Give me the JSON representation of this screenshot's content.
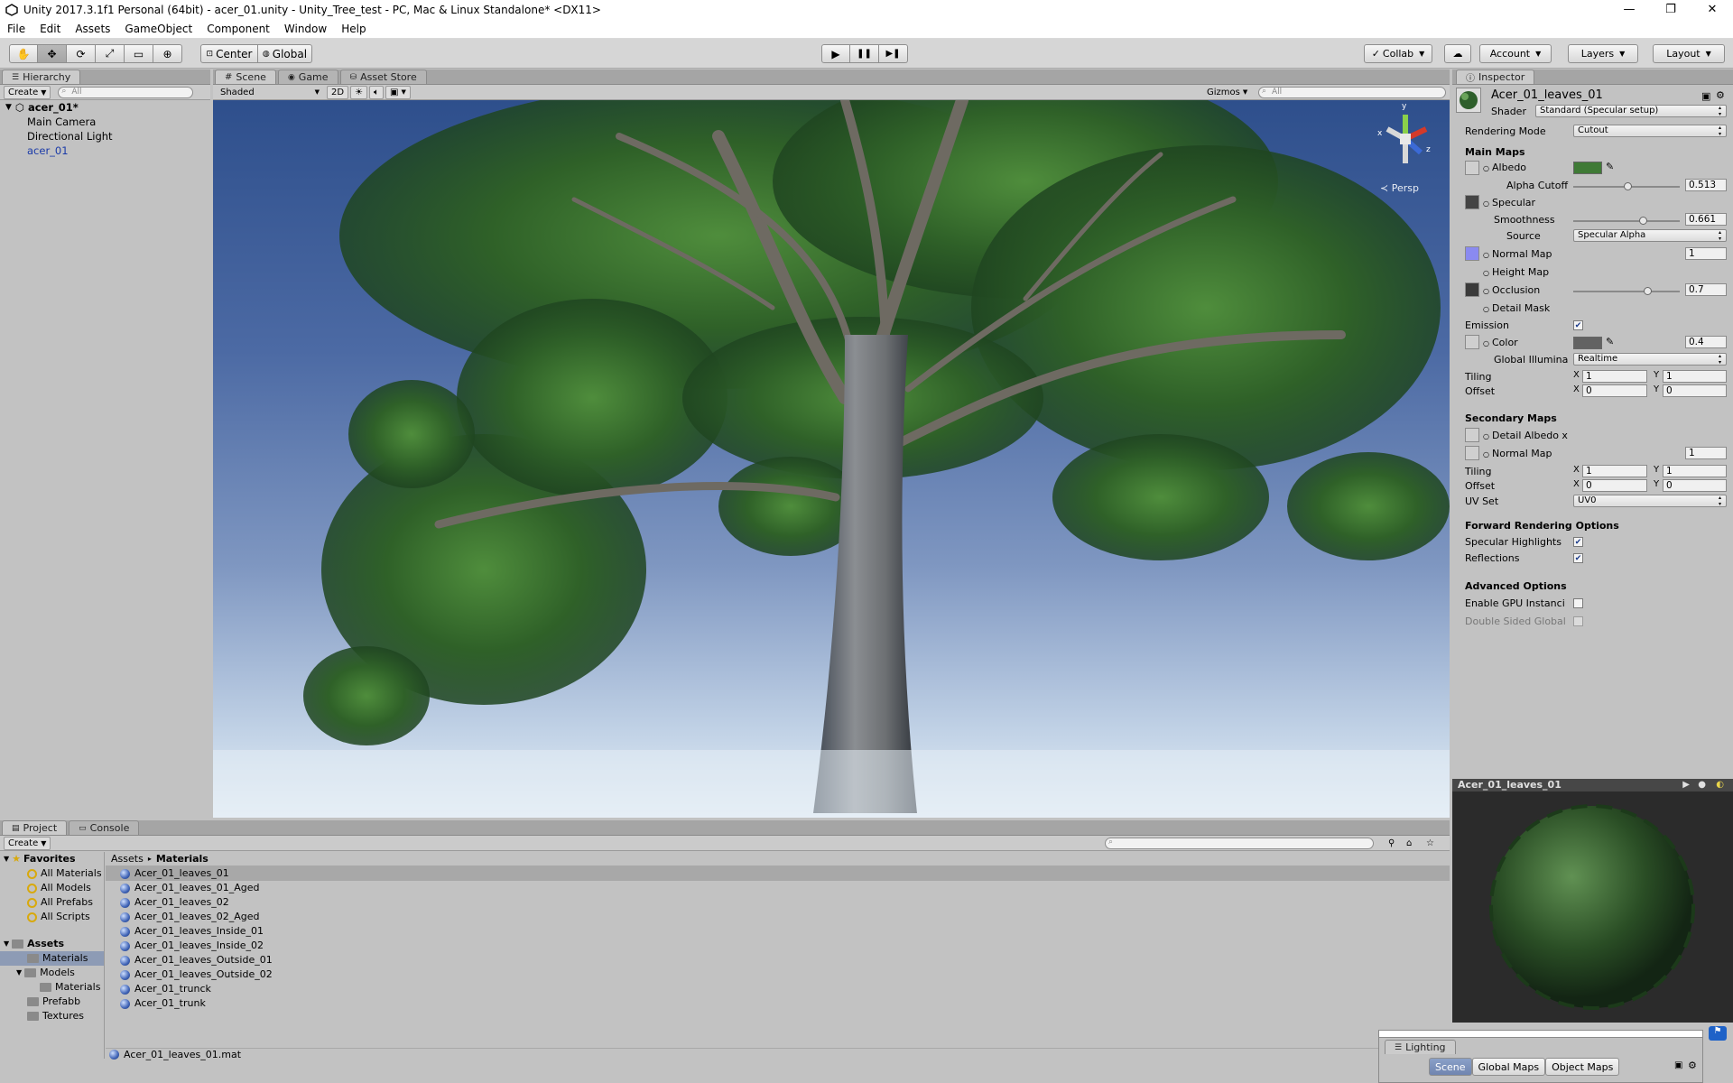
{
  "window": {
    "title": "Unity 2017.3.1f1 Personal (64bit) - acer_01.unity - Unity_Tree_test - PC, Mac & Linux Standalone* <DX11>",
    "controls": [
      "—",
      "❐",
      "✕"
    ]
  },
  "menu": [
    "File",
    "Edit",
    "Assets",
    "GameObject",
    "Component",
    "Window",
    "Help"
  ],
  "toolbar": {
    "tools": [
      "hand-tool",
      "move-tool",
      "rotate-tool",
      "scale-tool",
      "rect-tool",
      "transform-tool"
    ],
    "pivot_label": "Center",
    "space_label": "Global",
    "play_icons": [
      "▶",
      "❚❚",
      "▶❚"
    ],
    "collab_label": "Collab",
    "account_label": "Account",
    "layers_label": "Layers",
    "layout_label": "Layout"
  },
  "hierarchy": {
    "tab_label": "Hierarchy",
    "create_label": "Create",
    "search_placeholder": "All",
    "scene_name": "acer_01*",
    "items": [
      "Main Camera",
      "Directional Light",
      "acer_01"
    ]
  },
  "scene": {
    "tabs": [
      "Scene",
      "Game",
      "Asset Store"
    ],
    "shading_mode": "Shaded",
    "mode_2d": "2D",
    "gizmos_label": "Gizmos",
    "search_placeholder": "All",
    "persp_label": "Persp",
    "axis_labels": [
      "y",
      "z",
      "x"
    ]
  },
  "inspector": {
    "tab_label": "Inspector",
    "material_name": "Acer_01_leaves_01",
    "shader_label": "Shader",
    "shader_value": "Standard (Specular setup)",
    "rendering_mode_label": "Rendering Mode",
    "rendering_mode_value": "Cutout",
    "main_maps_header": "Main Maps",
    "albedo_label": "Albedo",
    "albedo_color": "#3f7a36",
    "alpha_cutoff_label": "Alpha Cutoff",
    "alpha_cutoff_value": "0.513",
    "alpha_cutoff_fraction": 0.513,
    "specular_label": "Specular",
    "smoothness_label": "Smoothness",
    "smoothness_value": "0.661",
    "smoothness_fraction": 0.661,
    "source_label": "Source",
    "source_value": "Specular Alpha",
    "normal_map_label": "Normal Map",
    "normal_map_value": "1",
    "height_map_label": "Height Map",
    "occlusion_label": "Occlusion",
    "occlusion_value": "0.7",
    "occlusion_fraction": 0.7,
    "detail_mask_label": "Detail Mask",
    "emission_label": "Emission",
    "emission_checked": true,
    "color_label": "Color",
    "emission_color": "#626262",
    "emission_value": "0.4",
    "gi_label": "Global Illumina",
    "gi_value": "Realtime",
    "tiling_label": "Tiling",
    "offset_label": "Offset",
    "main_tiling": {
      "x": "1",
      "y": "1"
    },
    "main_offset": {
      "x": "0",
      "y": "0"
    },
    "x_label": "X",
    "y_label": "Y",
    "secondary_maps_header": "Secondary Maps",
    "detail_albedo_label": "Detail Albedo x",
    "secondary_normal_label": "Normal Map",
    "secondary_normal_value": "1",
    "secondary_tiling": {
      "x": "1",
      "y": "1"
    },
    "secondary_offset": {
      "x": "0",
      "y": "0"
    },
    "uv_set_label": "UV Set",
    "uv_set_value": "UV0",
    "forward_header": "Forward Rendering Options",
    "specular_highlights_label": "Specular Highlights",
    "specular_highlights_checked": true,
    "reflections_label": "Reflections",
    "reflections_checked": true,
    "advanced_header": "Advanced Options",
    "gpu_instancing_label": "Enable GPU Instanci",
    "gpu_instancing_checked": false,
    "double_sided_label": "Double Sided Global",
    "double_sided_checked": false
  },
  "preview": {
    "title": "Acer_01_leaves_01"
  },
  "project": {
    "tabs": [
      "Project",
      "Console"
    ],
    "create_label": "Create",
    "favorites_header": "Favorites",
    "favorites": [
      "All Materials",
      "All Models",
      "All Prefabs",
      "All Scripts"
    ],
    "assets_header": "Assets",
    "tree": [
      {
        "label": "Materials",
        "indent": 1,
        "selected": true
      },
      {
        "label": "Models",
        "indent": 1,
        "selected": false
      },
      {
        "label": "Materials",
        "indent": 2,
        "selected": false
      },
      {
        "label": "Prefabb",
        "indent": 1,
        "selected": false
      },
      {
        "label": "Textures",
        "indent": 1,
        "selected": false
      }
    ],
    "breadcrumb": [
      "Assets",
      "Materials"
    ],
    "breadcrumb_sep": "▸",
    "files": [
      "Acer_01_leaves_01",
      "Acer_01_leaves_01_Aged",
      "Acer_01_leaves_02",
      "Acer_01_leaves_02_Aged",
      "Acer_01_leaves_Inside_01",
      "Acer_01_leaves_Inside_02",
      "Acer_01_leaves_Outside_01",
      "Acer_01_leaves_Outside_02",
      "Acer_01_trunck",
      "Acer_01_trunk"
    ],
    "selected_file": "Acer_01_leaves_01",
    "footer_path": "Acer_01_leaves_01.mat"
  },
  "lighting": {
    "tab_label": "Lighting",
    "tabs": [
      "Scene",
      "Global Maps",
      "Object Maps"
    ]
  }
}
